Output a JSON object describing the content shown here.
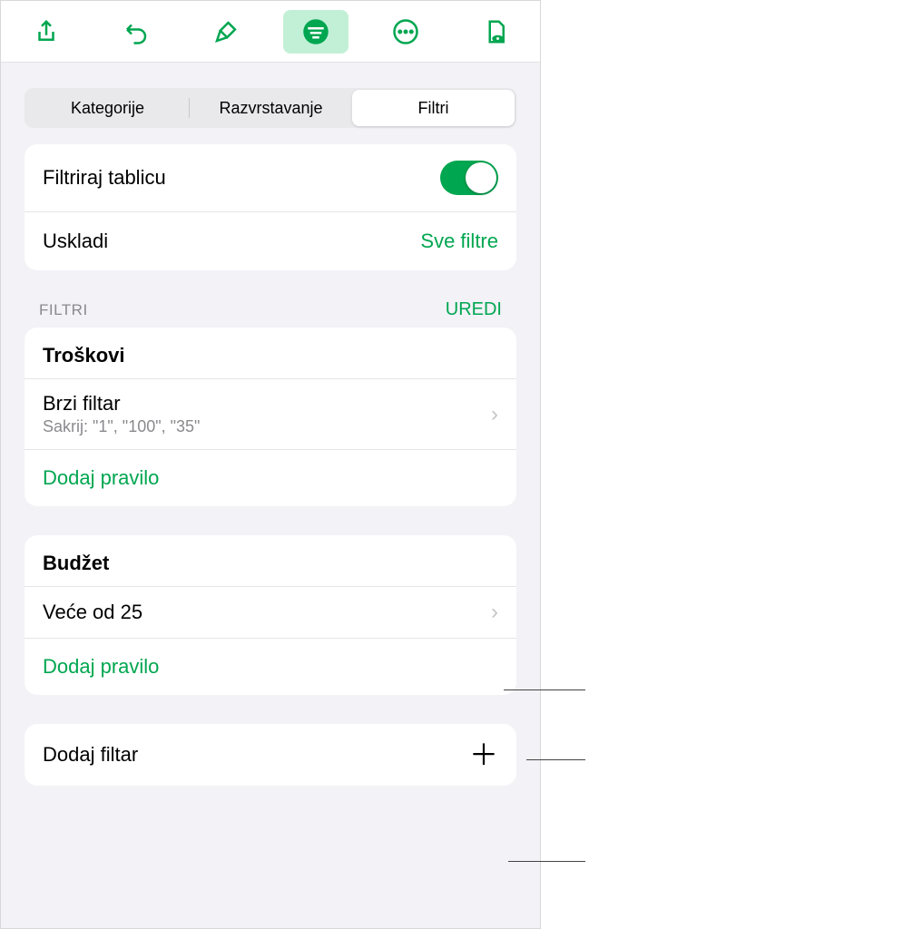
{
  "toolbar": {
    "icons": [
      "share-icon",
      "undo-icon",
      "brush-icon",
      "filter-lines-icon",
      "more-icon",
      "document-eye-icon"
    ]
  },
  "segmented": {
    "items": [
      "Kategorije",
      "Razvrstavanje",
      "Filtri"
    ],
    "selected": 2
  },
  "general": {
    "filter_table_label": "Filtriraj tablicu",
    "match_label": "Uskladi",
    "match_value": "Sve filtre"
  },
  "section": {
    "title": "FILTRI",
    "edit": "UREDI"
  },
  "filters": [
    {
      "title": "Troškovi",
      "rules": [
        {
          "label": "Brzi filtar",
          "sub": "Sakrij: \"1\", \"100\", \"35\""
        }
      ],
      "add_rule": "Dodaj pravilo"
    },
    {
      "title": "Budžet",
      "rules": [
        {
          "label": "Veće od 25",
          "sub": ""
        }
      ],
      "add_rule": "Dodaj pravilo"
    }
  ],
  "add_filter": "Dodaj filtar"
}
